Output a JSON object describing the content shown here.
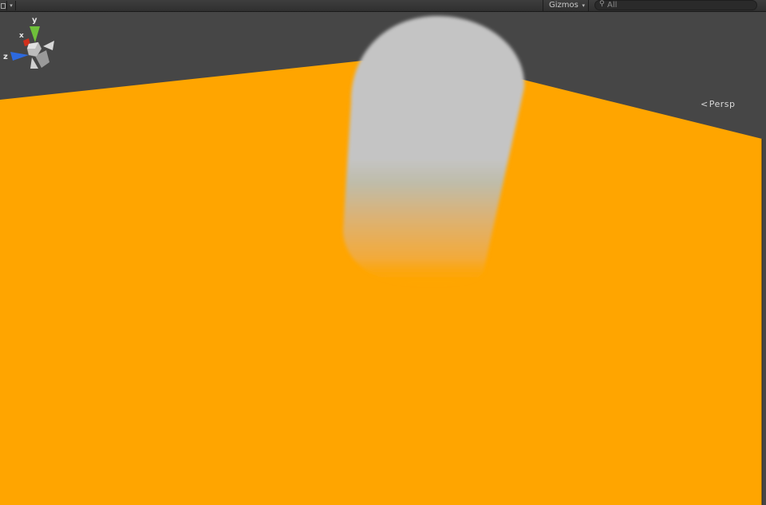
{
  "toolbar": {
    "gizmos_label": "Gizmos",
    "search_placeholder": "All"
  },
  "scene": {
    "projection_label": "Persp",
    "axis_labels": {
      "y": "y",
      "x": "x",
      "z": "z"
    }
  },
  "colors": {
    "background": "#464646",
    "ground_plane": "#ffa500",
    "capsule": "#c4c4c4",
    "axis_y": "#6fc03a",
    "axis_x": "#d0301c",
    "axis_z": "#2d6ae0"
  },
  "icons": [
    "layout-icon",
    "dropdown-arrow-icon",
    "search-icon",
    "scene-orientation-gizmo-icon",
    "perspective-chevron-icon"
  ]
}
